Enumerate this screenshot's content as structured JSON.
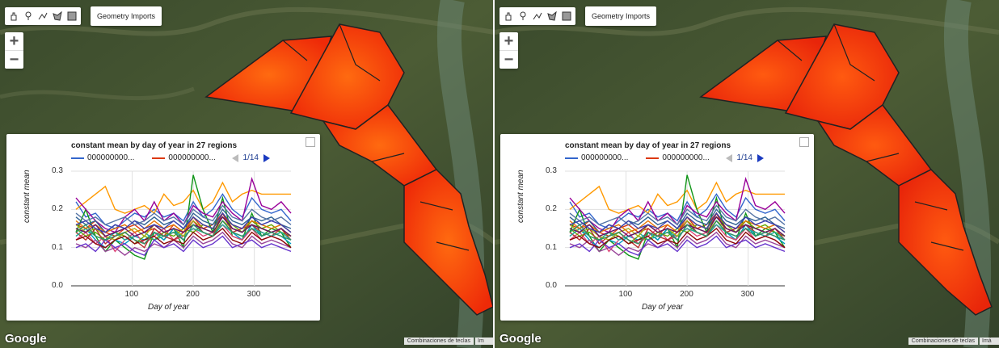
{
  "panels": [
    {
      "id": "left",
      "geometry_imports_label": "Geometry Imports",
      "chart": {
        "title": "constant mean by day of year in 27 regions",
        "legend": [
          {
            "label": "000000000...",
            "color": "#3366cc"
          },
          {
            "label": "000000000...",
            "color": "#dc3912"
          }
        ],
        "page": "1/14",
        "ylabel": "constant mean",
        "xlabel": "Day of year"
      },
      "google_label": "Google",
      "attribution": "Combinaciones de teclas",
      "attribution2": "Im"
    },
    {
      "id": "right",
      "geometry_imports_label": "Geometry Imports",
      "chart": {
        "title": "constant mean by day of year in 27 regions",
        "legend": [
          {
            "label": "000000000...",
            "color": "#3366cc"
          },
          {
            "label": "000000000...",
            "color": "#dc3912"
          }
        ],
        "page": "1/14",
        "ylabel": "constant mean",
        "xlabel": "Day of year"
      },
      "google_label": "Google",
      "attribution": "Combinaciones de teclas",
      "attribution2": "Imá"
    }
  ],
  "chart_data": {
    "type": "line",
    "title": "constant mean by day of year in 27 regions",
    "xlabel": "Day of year",
    "ylabel": "constant mean",
    "xlim": [
      0,
      360
    ],
    "ylim": [
      0,
      0.3
    ],
    "xticks": [
      100,
      200,
      300
    ],
    "yticks": [
      "0.0",
      "0.1",
      "0.2",
      "0.3"
    ],
    "x": [
      8,
      24,
      40,
      56,
      72,
      88,
      104,
      120,
      136,
      152,
      168,
      184,
      200,
      216,
      232,
      248,
      264,
      280,
      296,
      312,
      328,
      344,
      360
    ],
    "series": [
      {
        "color": "#3366cc",
        "values": [
          0.22,
          0.18,
          0.19,
          0.16,
          0.15,
          0.17,
          0.19,
          0.18,
          0.2,
          0.18,
          0.19,
          0.17,
          0.22,
          0.18,
          0.2,
          0.24,
          0.2,
          0.18,
          0.23,
          0.2,
          0.19,
          0.2,
          0.17
        ]
      },
      {
        "color": "#dc3912",
        "values": [
          0.16,
          0.15,
          0.17,
          0.14,
          0.13,
          0.15,
          0.16,
          0.14,
          0.15,
          0.13,
          0.16,
          0.14,
          0.18,
          0.15,
          0.16,
          0.19,
          0.15,
          0.14,
          0.17,
          0.15,
          0.14,
          0.15,
          0.13
        ]
      },
      {
        "color": "#ff9900",
        "values": [
          0.2,
          0.22,
          0.24,
          0.26,
          0.2,
          0.19,
          0.2,
          0.21,
          0.19,
          0.24,
          0.21,
          0.22,
          0.25,
          0.2,
          0.22,
          0.27,
          0.22,
          0.24,
          0.25,
          0.24,
          0.24,
          0.24,
          0.24
        ]
      },
      {
        "color": "#109618",
        "values": [
          0.14,
          0.2,
          0.13,
          0.09,
          0.12,
          0.1,
          0.08,
          0.07,
          0.14,
          0.12,
          0.15,
          0.1,
          0.29,
          0.2,
          0.14,
          0.23,
          0.13,
          0.12,
          0.19,
          0.13,
          0.15,
          0.14,
          0.1
        ]
      },
      {
        "color": "#990099",
        "values": [
          0.23,
          0.2,
          0.17,
          0.15,
          0.14,
          0.18,
          0.2,
          0.17,
          0.22,
          0.17,
          0.19,
          0.16,
          0.21,
          0.19,
          0.18,
          0.22,
          0.19,
          0.17,
          0.28,
          0.21,
          0.2,
          0.22,
          0.19
        ]
      },
      {
        "color": "#0099c6",
        "values": [
          0.13,
          0.15,
          0.12,
          0.1,
          0.12,
          0.11,
          0.13,
          0.12,
          0.14,
          0.12,
          0.15,
          0.12,
          0.16,
          0.14,
          0.13,
          0.17,
          0.14,
          0.12,
          0.16,
          0.13,
          0.14,
          0.13,
          0.11
        ]
      },
      {
        "color": "#dd4477",
        "values": [
          0.12,
          0.14,
          0.11,
          0.13,
          0.09,
          0.12,
          0.14,
          0.11,
          0.13,
          0.15,
          0.12,
          0.13,
          0.15,
          0.13,
          0.14,
          0.16,
          0.13,
          0.12,
          0.15,
          0.12,
          0.13,
          0.12,
          0.1
        ]
      },
      {
        "color": "#66aa00",
        "values": [
          0.15,
          0.13,
          0.14,
          0.12,
          0.14,
          0.13,
          0.11,
          0.13,
          0.12,
          0.14,
          0.13,
          0.15,
          0.14,
          0.16,
          0.15,
          0.18,
          0.16,
          0.14,
          0.17,
          0.15,
          0.16,
          0.14,
          0.13
        ]
      },
      {
        "color": "#b82e2e",
        "values": [
          0.14,
          0.12,
          0.15,
          0.11,
          0.13,
          0.14,
          0.12,
          0.1,
          0.15,
          0.13,
          0.12,
          0.14,
          0.17,
          0.14,
          0.13,
          0.19,
          0.14,
          0.15,
          0.16,
          0.14,
          0.13,
          0.15,
          0.12
        ]
      },
      {
        "color": "#316395",
        "values": [
          0.18,
          0.16,
          0.17,
          0.14,
          0.16,
          0.15,
          0.17,
          0.16,
          0.18,
          0.16,
          0.17,
          0.15,
          0.19,
          0.17,
          0.16,
          0.2,
          0.17,
          0.16,
          0.18,
          0.17,
          0.18,
          0.16,
          0.15
        ]
      },
      {
        "color": "#994499",
        "values": [
          0.11,
          0.1,
          0.12,
          0.09,
          0.1,
          0.08,
          0.1,
          0.09,
          0.11,
          0.1,
          0.12,
          0.1,
          0.13,
          0.11,
          0.12,
          0.14,
          0.11,
          0.1,
          0.13,
          0.11,
          0.12,
          0.11,
          0.1
        ]
      },
      {
        "color": "#22aa99",
        "values": [
          0.13,
          0.15,
          0.13,
          0.12,
          0.14,
          0.12,
          0.13,
          0.14,
          0.12,
          0.13,
          0.14,
          0.13,
          0.15,
          0.14,
          0.13,
          0.16,
          0.14,
          0.13,
          0.15,
          0.14,
          0.13,
          0.14,
          0.12
        ]
      },
      {
        "color": "#aaaa11",
        "values": [
          0.16,
          0.14,
          0.15,
          0.13,
          0.12,
          0.14,
          0.15,
          0.13,
          0.16,
          0.14,
          0.15,
          0.13,
          0.17,
          0.15,
          0.14,
          0.17,
          0.15,
          0.14,
          0.16,
          0.15,
          0.14,
          0.15,
          0.13
        ]
      },
      {
        "color": "#6633cc",
        "values": [
          0.1,
          0.11,
          0.09,
          0.12,
          0.1,
          0.11,
          0.09,
          0.08,
          0.12,
          0.1,
          0.11,
          0.09,
          0.12,
          0.1,
          0.11,
          0.13,
          0.1,
          0.11,
          0.12,
          0.1,
          0.11,
          0.1,
          0.09
        ]
      },
      {
        "color": "#e67300",
        "values": [
          0.17,
          0.15,
          0.16,
          0.14,
          0.15,
          0.16,
          0.14,
          0.15,
          0.17,
          0.15,
          0.16,
          0.14,
          0.18,
          0.16,
          0.15,
          0.19,
          0.16,
          0.15,
          0.17,
          0.16,
          0.15,
          0.16,
          0.14
        ]
      },
      {
        "color": "#8b0707",
        "values": [
          0.12,
          0.13,
          0.11,
          0.1,
          0.12,
          0.13,
          0.11,
          0.12,
          0.13,
          0.11,
          0.12,
          0.11,
          0.14,
          0.12,
          0.13,
          0.15,
          0.12,
          0.11,
          0.14,
          0.12,
          0.13,
          0.12,
          0.1
        ]
      },
      {
        "color": "#651067",
        "values": [
          0.15,
          0.14,
          0.16,
          0.13,
          0.14,
          0.15,
          0.13,
          0.14,
          0.16,
          0.14,
          0.15,
          0.14,
          0.16,
          0.15,
          0.14,
          0.18,
          0.15,
          0.14,
          0.16,
          0.15,
          0.14,
          0.15,
          0.13
        ]
      },
      {
        "color": "#329262",
        "values": [
          0.14,
          0.16,
          0.13,
          0.12,
          0.13,
          0.14,
          0.12,
          0.11,
          0.14,
          0.13,
          0.14,
          0.12,
          0.16,
          0.14,
          0.13,
          0.17,
          0.14,
          0.13,
          0.15,
          0.13,
          0.14,
          0.13,
          0.12
        ]
      },
      {
        "color": "#5574a6",
        "values": [
          0.19,
          0.17,
          0.18,
          0.16,
          0.17,
          0.18,
          0.16,
          0.17,
          0.19,
          0.17,
          0.18,
          0.16,
          0.2,
          0.18,
          0.17,
          0.21,
          0.18,
          0.17,
          0.2,
          0.18,
          0.17,
          0.18,
          0.16
        ]
      },
      {
        "color": "#3b3eac",
        "values": [
          0.16,
          0.17,
          0.15,
          0.14,
          0.16,
          0.15,
          0.17,
          0.15,
          0.16,
          0.15,
          0.17,
          0.15,
          0.18,
          0.16,
          0.15,
          0.19,
          0.16,
          0.15,
          0.18,
          0.16,
          0.17,
          0.16,
          0.14
        ]
      }
    ]
  }
}
